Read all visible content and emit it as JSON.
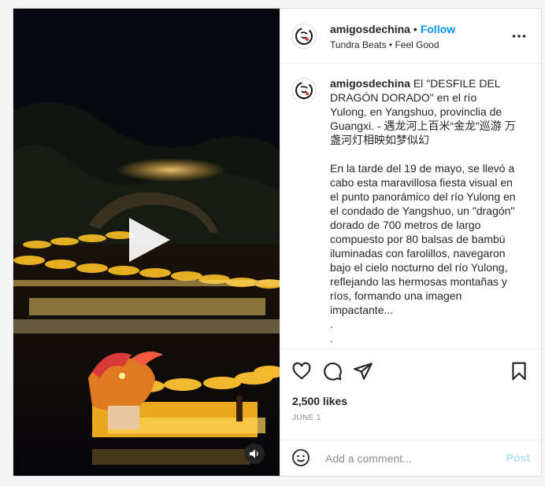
{
  "post": {
    "username": "amigosdechina",
    "follow_separator": "•",
    "follow_label": "Follow",
    "audio": "Tundra Beats • Feel Good",
    "caption_lines": [
      "El \"DESFILE DEL DRAGÓN DORADO\" en el río Yulong, en Yangshuo, provinclia de Guangxi. - 遇龙河上百米“金龙”巡游 万盏河灯相映如梦似幻"
    ],
    "caption_body": "En la tarde del 19 de mayo, se llevó a cabo esta maravillosa fiesta visual en el punto panorámico del río Yulong en el condado de Yangshuo, un \"dragón\" dorado de 700 metros de largo compuesto por 80 balsas de bambú iluminadas con farolillos, navegaron bajo el cielo nocturno del río Yulong, reflejando las hermosas montañas y ríos, formando una imagen impactante...",
    "caption_dots": [
      ".",
      "."
    ],
    "likes": "2,500 likes",
    "date": "JUNE 1",
    "comment_placeholder": "Add a comment...",
    "post_label": "Post"
  },
  "icons": {
    "more": "more-options-icon",
    "like": "heart-icon",
    "comment": "comment-icon",
    "share": "share-icon",
    "save": "bookmark-icon",
    "emoji": "emoji-icon",
    "play": "play-icon",
    "mute": "speaker-icon"
  },
  "colors": {
    "accent": "#0095f6",
    "post_disabled": "#b2dffc",
    "text": "#262626",
    "muted": "#8e8e8e"
  }
}
